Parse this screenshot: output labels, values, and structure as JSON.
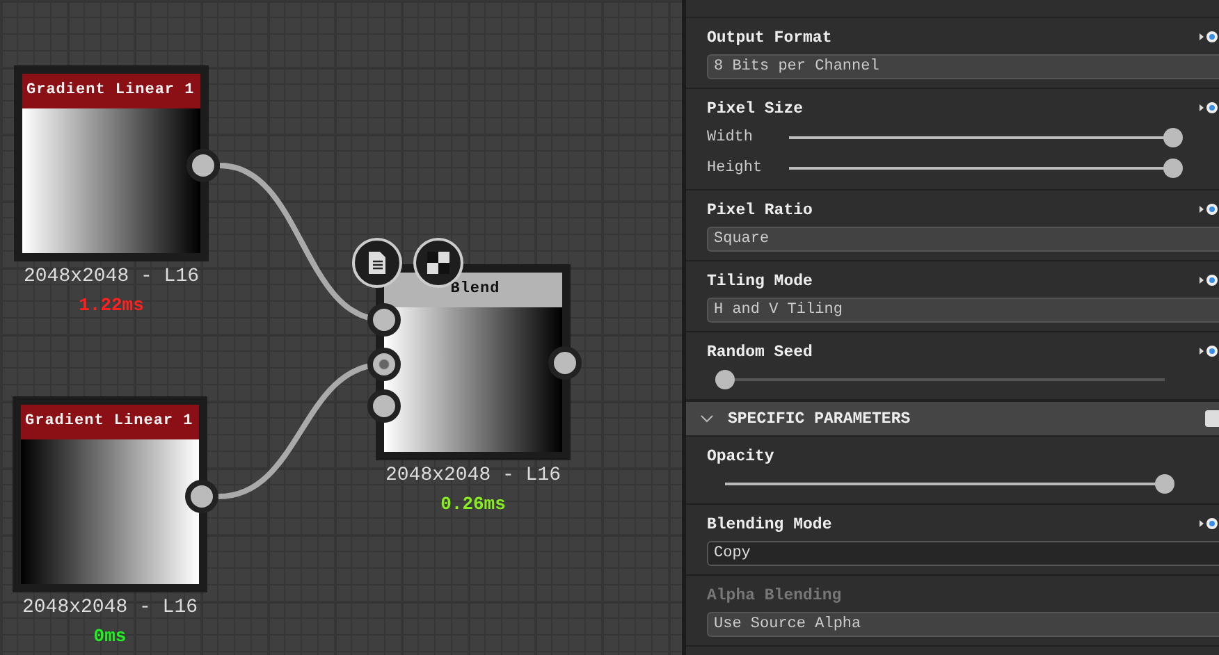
{
  "graph": {
    "nodes": [
      {
        "kind": "source",
        "title": "Gradient Linear 1",
        "size": "2048x2048 - L16",
        "timing": "1.22ms",
        "color": "#ff2020"
      },
      {
        "kind": "source",
        "title": "Gradient Linear 1",
        "size": "2048x2048 - L16",
        "timing": "0ms",
        "color": "#22ee22"
      },
      {
        "kind": "blend",
        "title": "Blend",
        "size": "2048x2048 - L16",
        "timing": "0.26ms",
        "color": "#88ee22"
      }
    ]
  },
  "panel": {
    "sections": [
      {
        "kind": "dropdown",
        "label": "Output Format",
        "value": "8 Bits per Channel",
        "disabled": false,
        "dark": false
      },
      {
        "kind": "sliders",
        "label": "Pixel Size",
        "sliders": [
          {
            "label": "Width",
            "level": 1
          },
          {
            "label": "Height",
            "level": 1
          }
        ]
      },
      {
        "kind": "dropdown",
        "label": "Pixel Ratio",
        "value": "Square",
        "disabled": false,
        "dark": false
      },
      {
        "kind": "dropdown",
        "label": "Tiling Mode",
        "value": "H and V Tiling",
        "disabled": false,
        "dark": false
      },
      {
        "kind": "slider",
        "label": "Random Seed",
        "level": 0
      },
      {
        "kind": "header",
        "label": "SPECIFIC PARAMETERS",
        "expanded": true
      },
      {
        "kind": "slider",
        "label": "Opacity",
        "level": 1
      },
      {
        "kind": "dropdown",
        "label": "Blending Mode",
        "value": "Copy",
        "disabled": false,
        "dark": true
      },
      {
        "kind": "dropdown",
        "label": "Alpha Blending",
        "value": "Use Source Alpha",
        "disabled": true,
        "dark": false
      }
    ]
  }
}
